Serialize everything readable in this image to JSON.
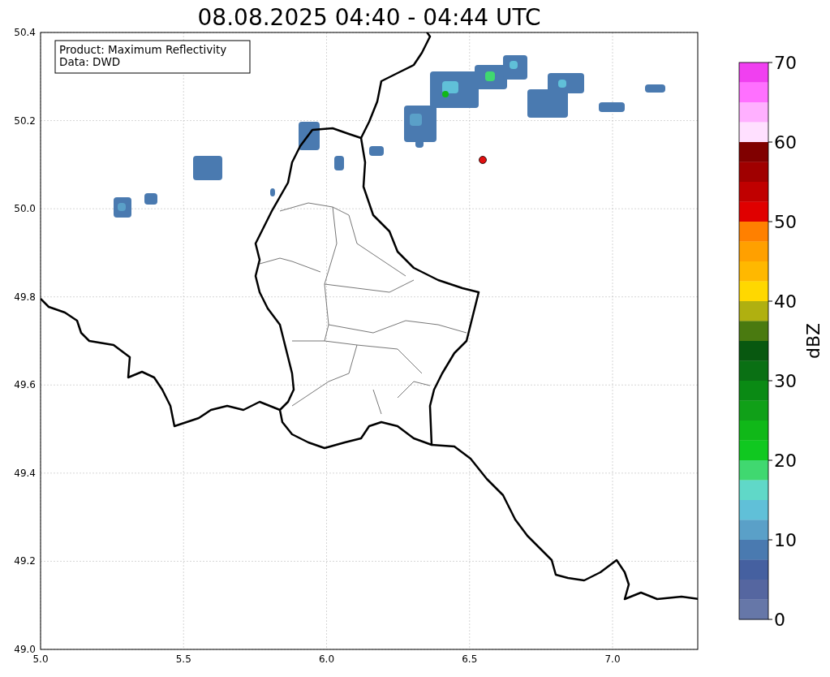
{
  "title": "08.08.2025 04:40 - 04:44 UTC",
  "map": {
    "info_box": [
      "Product: Maximum Reflectivity",
      "Data: DWD"
    ],
    "y_ticks": [
      "50.4",
      "50.2",
      "50.0",
      "49.8",
      "49.6",
      "49.4",
      "49.2",
      "49.0"
    ],
    "x_ticks": [
      "5.0",
      "5.5",
      "6.0",
      "6.5",
      "7.0"
    ]
  },
  "colorbar": {
    "label": "dBZ",
    "ticks": [
      "70",
      "60",
      "50",
      "40",
      "30",
      "20",
      "10",
      "0"
    ],
    "bins": [
      {
        "color": "#f040f0"
      },
      {
        "color": "#ff70ff"
      },
      {
        "color": "#ffb0ff"
      },
      {
        "color": "#ffe0ff"
      },
      {
        "color": "#800000"
      },
      {
        "color": "#a00000"
      },
      {
        "color": "#c00000"
      },
      {
        "color": "#e00000"
      },
      {
        "color": "#ff8000"
      },
      {
        "color": "#ffa000"
      },
      {
        "color": "#ffb800"
      },
      {
        "color": "#ffd800"
      },
      {
        "color": "#b0b010"
      },
      {
        "color": "#4a7a10"
      },
      {
        "color": "#085810"
      },
      {
        "color": "#0a7014"
      },
      {
        "color": "#0a8a14"
      },
      {
        "color": "#10a018"
      },
      {
        "color": "#10b818"
      },
      {
        "color": "#10c820"
      },
      {
        "color": "#40d870"
      },
      {
        "color": "#60d8c8"
      },
      {
        "color": "#60c0d8"
      },
      {
        "color": "#5aa0c8"
      },
      {
        "color": "#4a7ab0"
      },
      {
        "color": "#4560a0"
      },
      {
        "color": "#5566a0"
      },
      {
        "color": "#6677a8"
      }
    ]
  }
}
